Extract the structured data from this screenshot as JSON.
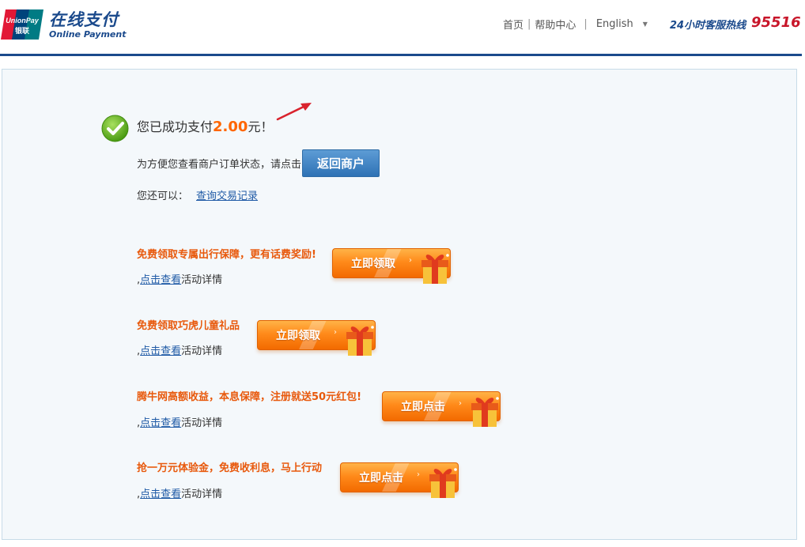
{
  "header": {
    "logo_badge": "UnionPay 银联",
    "logo_cn": "在线支付",
    "logo_en": "Online Payment",
    "nav": {
      "home": "首页",
      "help": "帮助中心",
      "sep": "|",
      "language": "English"
    },
    "hotline_label": "24小时客服热线",
    "hotline_number": "95516"
  },
  "status": {
    "prefix": "您已成功支付",
    "amount": "2.00",
    "suffix": "元！"
  },
  "back": {
    "text": "为方便您查看商户订单状态，请点击",
    "button": "返回商户"
  },
  "also": {
    "text": "您还可以：",
    "link": "查询交易记录"
  },
  "promos": [
    {
      "title": "免费领取专属出行保障，更有话费奖励!",
      "prefix": ",",
      "link": "点击查看",
      "suffix": "活动详情",
      "button": "立即领取"
    },
    {
      "title": "免费领取巧虎儿童礼品",
      "prefix": ",",
      "link": "点击查看",
      "suffix": "活动详情",
      "button": "立即领取"
    },
    {
      "title": "腾牛网高额收益，本息保障，注册就送50元红包!",
      "prefix": ",",
      "link": "点击查看",
      "suffix": "活动详情",
      "button": "立即点击"
    },
    {
      "title": "抢一万元体验金，免费收利息，马上行动",
      "prefix": ",",
      "link": "点击查看",
      "suffix": "活动详情",
      "button": "立即点击"
    }
  ],
  "colors": {
    "brand_blue": "#1b4a8c",
    "hotline_red": "#c8162a",
    "amount_orange": "#ff6600",
    "promo_orange": "#e8590c",
    "link_blue": "#1f5aa6"
  }
}
